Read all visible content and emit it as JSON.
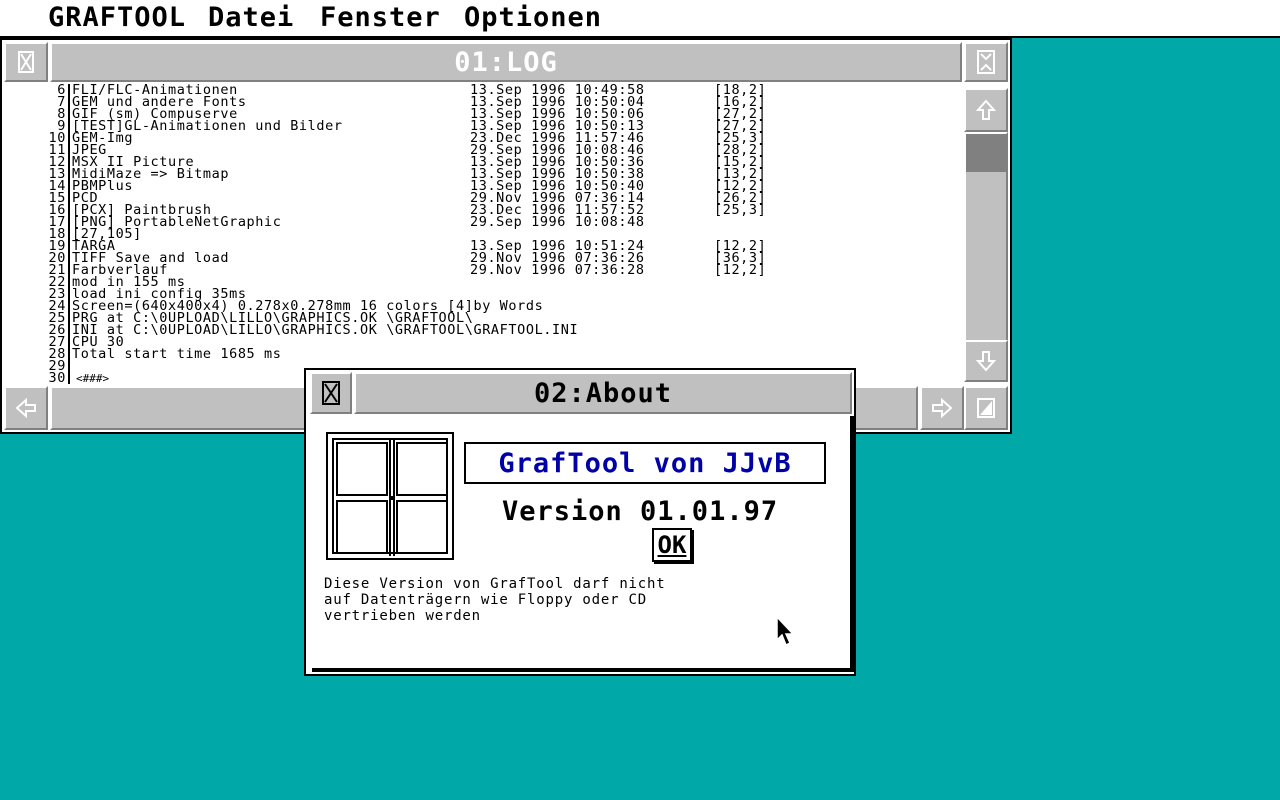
{
  "menubar": {
    "items": [
      "GRAFTOOL",
      "Datei",
      "Fenster",
      "Optionen"
    ]
  },
  "log_window": {
    "title": "01:LOG",
    "lines": [
      {
        "num": "6",
        "text": "FLI/FLC-Animationen",
        "date": "13.Sep 1996 10:49:58",
        "size": "[18,2]"
      },
      {
        "num": "7",
        "text": "GEM und andere Fonts",
        "date": "13.Sep 1996 10:50:04",
        "size": "[16,2]"
      },
      {
        "num": "8",
        "text": "GIF (sm) Compuserve",
        "date": "13.Sep 1996 10:50:06",
        "size": "[27,2]"
      },
      {
        "num": "9",
        "text": "[TEST]GL-Animationen und Bilder",
        "date": "13.Sep 1996 10:50:13",
        "size": "[27,2]"
      },
      {
        "num": "10",
        "text": "GEM-Img",
        "date": "23.Dec 1996 11:57:46",
        "size": "[25,3]"
      },
      {
        "num": "11",
        "text": "JPEG",
        "date": "29.Sep 1996 10:08:46",
        "size": "[28,2]"
      },
      {
        "num": "12",
        "text": "MSX II Picture",
        "date": "13.Sep 1996 10:50:36",
        "size": "[15,2]"
      },
      {
        "num": "13",
        "text": "MidiMaze => Bitmap",
        "date": "13.Sep 1996 10:50:38",
        "size": "[13,2]"
      },
      {
        "num": "14",
        "text": "PBMPlus",
        "date": "13.Sep 1996 10:50:40",
        "size": "[12,2]"
      },
      {
        "num": "15",
        "text": "PCD",
        "date": "29.Nov 1996 07:36:14",
        "size": "[26,2]"
      },
      {
        "num": "16",
        "text": "[PCX] Paintbrush",
        "date": "23.Dec 1996 11:57:52",
        "size": "[25,3]"
      },
      {
        "num": "17",
        "text": "[PNG] PortableNetGraphic",
        "date": "29.Sep 1996 10:08:48",
        "size": ""
      },
      {
        "num": "18",
        "text": "[27,105]",
        "date": "",
        "size": ""
      },
      {
        "num": "19",
        "text": "TARGA",
        "date": "13.Sep 1996 10:51:24",
        "size": "[12,2]"
      },
      {
        "num": "20",
        "text": "TIFF Save and load",
        "date": "29.Nov 1996 07:36:26",
        "size": "[36,3]"
      },
      {
        "num": "21",
        "text": "Farbverlauf",
        "date": "29.Nov 1996 07:36:28",
        "size": "[12,2]"
      },
      {
        "num": "22",
        "text": "mod in 155 ms",
        "date": "",
        "size": ""
      },
      {
        "num": "23",
        "text": "load ini config 35ms",
        "date": "",
        "size": ""
      },
      {
        "num": "24",
        "text": "Screen=(640x400x4) 0.278x0.278mm 16 colors [4]by Words",
        "date": "",
        "size": ""
      },
      {
        "num": "25",
        "text": "PRG at C:\\0UPLOAD\\LILLO\\GRAPHICS.OK \\GRAFTOOL\\",
        "date": "",
        "size": ""
      },
      {
        "num": "26",
        "text": "INI at C:\\0UPLOAD\\LILLO\\GRAPHICS.OK \\GRAFTOOL\\GRAFTOOL.INI",
        "date": "",
        "size": ""
      },
      {
        "num": "27",
        "text": "CPU 30",
        "date": "",
        "size": ""
      },
      {
        "num": "28",
        "text": "Total start time 1685 ms",
        "date": "",
        "size": ""
      },
      {
        "num": "29",
        "text": "",
        "date": "",
        "size": ""
      },
      {
        "num": "30",
        "text": "",
        "date": "",
        "size": ""
      }
    ],
    "cursor": "<###>"
  },
  "about_window": {
    "title": "02:About",
    "app_title": "GrafTool von JJvB",
    "version": "Version 01.01.97",
    "ok_label": "OK",
    "notice": "Diese Version von GrafTool darf nicht\nauf Datenträgern wie Floppy oder CD\nvertrieben werden"
  },
  "icons": {
    "close": "close-icon",
    "full": "fuller-icon",
    "up": "arrow-up-icon",
    "down": "arrow-down-icon",
    "left": "arrow-left-icon",
    "right": "arrow-right-icon",
    "size": "sizer-icon"
  },
  "colors": {
    "desktop": "#00a8a8",
    "title_text_blue": "#0000a8",
    "chrome_gray": "#c0c0c0"
  }
}
